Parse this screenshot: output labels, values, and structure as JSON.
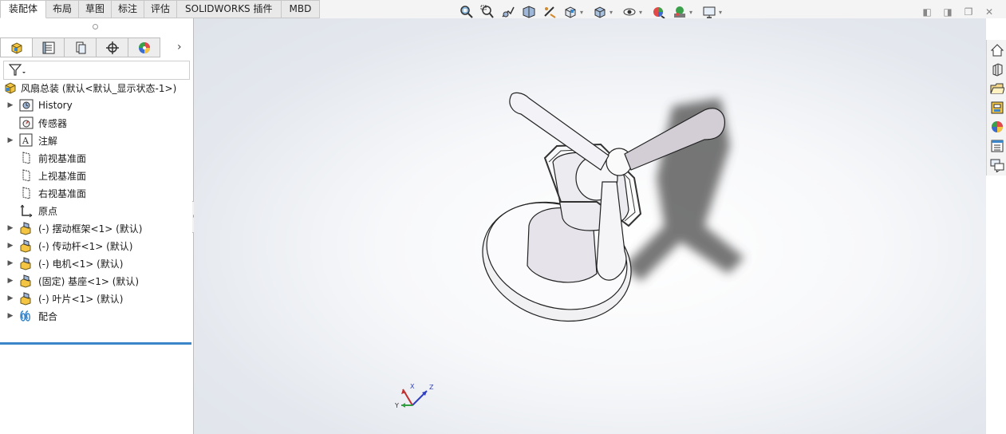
{
  "tabs": [
    {
      "label": "装配体",
      "active": true
    },
    {
      "label": "布局",
      "active": false
    },
    {
      "label": "草图",
      "active": false
    },
    {
      "label": "标注",
      "active": false
    },
    {
      "label": "评估",
      "active": false
    },
    {
      "label": "SOLIDWORKS 插件",
      "active": false
    },
    {
      "label": "MBD",
      "active": false
    }
  ],
  "view_toolbar_icons": [
    "zoom-to-fit-icon",
    "zoom-to-area-icon",
    "previous-view-icon",
    "section-view-icon",
    "dynamic-annotation-icon",
    "view-orientation-icon",
    "display-style-icon",
    "hide-show-icon",
    "edit-appearance-icon",
    "apply-scene-icon",
    "view-settings-icon"
  ],
  "window_controls": [
    "tile-left-icon",
    "tile-right-icon",
    "restore-icon",
    "close-icon"
  ],
  "feature_tabs": [
    "featuremanager-icon",
    "propertymanager-icon",
    "configurationmanager-icon",
    "dimxpert-icon",
    "display-manager-icon"
  ],
  "tree": {
    "root": "风扇总装 (默认<默认_显示状态-1>)",
    "items": [
      {
        "label": "History",
        "icon": "history-icon",
        "expandable": true
      },
      {
        "label": "传感器",
        "icon": "sensor-icon",
        "expandable": false
      },
      {
        "label": "注解",
        "icon": "annotation-icon",
        "expandable": true
      },
      {
        "label": "前视基准面",
        "icon": "plane-icon",
        "expandable": false
      },
      {
        "label": "上视基准面",
        "icon": "plane-icon",
        "expandable": false
      },
      {
        "label": "右视基准面",
        "icon": "plane-icon",
        "expandable": false
      },
      {
        "label": "原点",
        "icon": "origin-icon",
        "expandable": false
      },
      {
        "label": "(-) 摆动框架<1> (默认)",
        "icon": "part-icon",
        "expandable": true
      },
      {
        "label": "(-) 传动杆<1> (默认)",
        "icon": "part-icon",
        "expandable": true
      },
      {
        "label": "(-) 电机<1> (默认)",
        "icon": "part-icon",
        "expandable": true
      },
      {
        "label": "(固定) 基座<1> (默认)",
        "icon": "part-icon",
        "expandable": true
      },
      {
        "label": "(-) 叶片<1> (默认)",
        "icon": "part-icon",
        "expandable": true
      },
      {
        "label": "配合",
        "icon": "mates-icon",
        "expandable": true
      }
    ]
  },
  "triad": {
    "x": "X",
    "y": "Y",
    "z": "Z"
  },
  "task_pane_icons": [
    "solidworks-resources-icon",
    "design-library-icon",
    "file-explorer-icon",
    "view-palette-icon",
    "appearances-icon",
    "custom-properties-icon",
    "forum-icon"
  ],
  "colors": {
    "accent": "#3a86c8",
    "model_fill": "#e8e6ec",
    "blade_fill": "#d3cdd6",
    "shadow": "#4a4a4a"
  }
}
